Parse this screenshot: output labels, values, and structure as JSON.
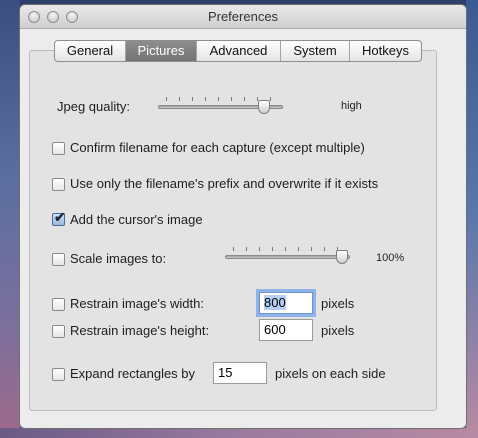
{
  "window": {
    "title": "Preferences"
  },
  "tabs": [
    {
      "label": "General",
      "active": false
    },
    {
      "label": "Pictures",
      "active": true
    },
    {
      "label": "Advanced",
      "active": false
    },
    {
      "label": "System",
      "active": false
    },
    {
      "label": "Hotkeys",
      "active": false
    }
  ],
  "jpeg": {
    "label": "Jpeg quality:",
    "value_text": "high",
    "level": 0.9
  },
  "options": {
    "confirm_filename": {
      "label": "Confirm filename for each capture (except multiple)",
      "checked": false
    },
    "prefix_overwrite": {
      "label": "Use only the filename's prefix and overwrite if it exists",
      "checked": false
    },
    "add_cursor": {
      "label": "Add the cursor's image",
      "checked": true
    },
    "scale_images": {
      "label": "Scale images to:",
      "checked": false,
      "value_text": "100%",
      "level": 1.0
    },
    "restrain_width": {
      "label": "Restrain image's width:",
      "checked": false,
      "value": "800",
      "unit": "pixels"
    },
    "restrain_height": {
      "label": "Restrain image's height:",
      "checked": false,
      "value": "600",
      "unit": "pixels"
    },
    "expand_rect": {
      "label": "Expand rectangles by",
      "checked": false,
      "value": "15",
      "unit": "pixels on each side"
    }
  },
  "colors": {
    "window_bg": "#ececec",
    "tab_active": "#7f7f7f",
    "focus_ring": "#8fb3e6",
    "check_blue": "#9cb9dc"
  }
}
